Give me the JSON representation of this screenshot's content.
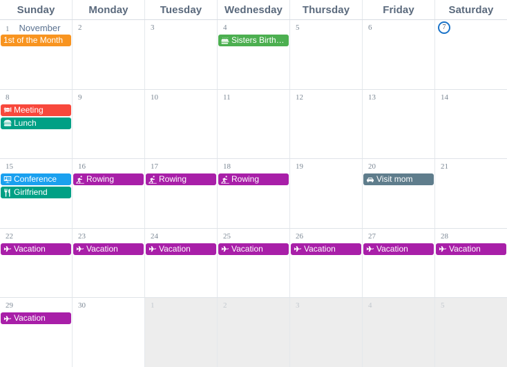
{
  "calendar": {
    "view": "month",
    "month_label": "November",
    "weekday_headers": [
      {
        "label": "Sunday"
      },
      {
        "label": "Monday"
      },
      {
        "label": "Tuesday"
      },
      {
        "label": "Wednesday"
      },
      {
        "label": "Thursday"
      },
      {
        "label": "Friday"
      },
      {
        "label": "Saturday"
      }
    ],
    "colors": {
      "event_orange": "#f89420",
      "event_green": "#4caf50",
      "event_red": "#f8483c",
      "event_teal": "#00a085",
      "event_blue": "#1aa0ef",
      "event_purple": "#a81fa8",
      "event_slate": "#5f7d8c",
      "today_ring": "#1a73c8",
      "other_month_bg": "#ededed",
      "grid_line": "#e4e8ec",
      "header_text": "#5b6a7d",
      "day_number_text": "#7b8794"
    },
    "weeks": [
      {
        "days": [
          {
            "number": "1",
            "other_month": false,
            "today": false,
            "month_label": "November",
            "events": [
              {
                "label": "1st of the Month",
                "icon": "none",
                "color": "#f89420"
              }
            ]
          },
          {
            "number": "2",
            "other_month": false,
            "today": false,
            "events": []
          },
          {
            "number": "3",
            "other_month": false,
            "today": false,
            "events": []
          },
          {
            "number": "4",
            "other_month": false,
            "today": false,
            "events": [
              {
                "label": "Sisters Birth…",
                "icon": "birthday-cake-icon",
                "color": "#4caf50"
              }
            ]
          },
          {
            "number": "5",
            "other_month": false,
            "today": false,
            "events": []
          },
          {
            "number": "6",
            "other_month": false,
            "today": false,
            "events": []
          },
          {
            "number": "7",
            "other_month": false,
            "today": true,
            "events": []
          }
        ]
      },
      {
        "days": [
          {
            "number": "8",
            "other_month": false,
            "today": false,
            "events": [
              {
                "label": "Meeting",
                "icon": "utensils-plate-icon",
                "color": "#f8483c"
              },
              {
                "label": "Lunch",
                "icon": "hamburger-icon",
                "color": "#00a085"
              }
            ]
          },
          {
            "number": "9",
            "other_month": false,
            "today": false,
            "events": []
          },
          {
            "number": "10",
            "other_month": false,
            "today": false,
            "events": []
          },
          {
            "number": "11",
            "other_month": false,
            "today": false,
            "events": []
          },
          {
            "number": "12",
            "other_month": false,
            "today": false,
            "events": []
          },
          {
            "number": "13",
            "other_month": false,
            "today": false,
            "events": []
          },
          {
            "number": "14",
            "other_month": false,
            "today": false,
            "events": []
          }
        ]
      },
      {
        "days": [
          {
            "number": "15",
            "other_month": false,
            "today": false,
            "events": [
              {
                "label": "Conference",
                "icon": "presentation-screen-icon",
                "color": "#1aa0ef"
              },
              {
                "label": "Girlfriend",
                "icon": "fork-knife-icon",
                "color": "#00a085"
              }
            ]
          },
          {
            "number": "16",
            "other_month": false,
            "today": false,
            "events": [
              {
                "label": "Rowing",
                "icon": "rowing-person-icon",
                "color": "#a81fa8"
              }
            ]
          },
          {
            "number": "17",
            "other_month": false,
            "today": false,
            "events": [
              {
                "label": "Rowing",
                "icon": "rowing-person-icon",
                "color": "#a81fa8"
              }
            ]
          },
          {
            "number": "18",
            "other_month": false,
            "today": false,
            "events": [
              {
                "label": "Rowing",
                "icon": "rowing-person-icon",
                "color": "#a81fa8"
              }
            ]
          },
          {
            "number": "19",
            "other_month": false,
            "today": false,
            "events": []
          },
          {
            "number": "20",
            "other_month": false,
            "today": false,
            "events": [
              {
                "label": "Visit mom",
                "icon": "car-icon",
                "color": "#5f7d8c"
              }
            ]
          },
          {
            "number": "21",
            "other_month": false,
            "today": false,
            "events": []
          }
        ]
      },
      {
        "days": [
          {
            "number": "22",
            "other_month": false,
            "today": false,
            "events": [
              {
                "label": "Vacation",
                "icon": "airplane-icon",
                "color": "#a81fa8"
              }
            ]
          },
          {
            "number": "23",
            "other_month": false,
            "today": false,
            "events": [
              {
                "label": "Vacation",
                "icon": "airplane-icon",
                "color": "#a81fa8"
              }
            ]
          },
          {
            "number": "24",
            "other_month": false,
            "today": false,
            "events": [
              {
                "label": "Vacation",
                "icon": "airplane-icon",
                "color": "#a81fa8"
              }
            ]
          },
          {
            "number": "25",
            "other_month": false,
            "today": false,
            "events": [
              {
                "label": "Vacation",
                "icon": "airplane-icon",
                "color": "#a81fa8"
              }
            ]
          },
          {
            "number": "26",
            "other_month": false,
            "today": false,
            "events": [
              {
                "label": "Vacation",
                "icon": "airplane-icon",
                "color": "#a81fa8"
              }
            ]
          },
          {
            "number": "27",
            "other_month": false,
            "today": false,
            "events": [
              {
                "label": "Vacation",
                "icon": "airplane-icon",
                "color": "#a81fa8"
              }
            ]
          },
          {
            "number": "28",
            "other_month": false,
            "today": false,
            "events": [
              {
                "label": "Vacation",
                "icon": "airplane-icon",
                "color": "#a81fa8"
              }
            ]
          }
        ]
      },
      {
        "days": [
          {
            "number": "29",
            "other_month": false,
            "today": false,
            "events": [
              {
                "label": "Vacation",
                "icon": "airplane-icon",
                "color": "#a81fa8"
              }
            ]
          },
          {
            "number": "30",
            "other_month": false,
            "today": false,
            "events": []
          },
          {
            "number": "1",
            "other_month": true,
            "today": false,
            "events": []
          },
          {
            "number": "2",
            "other_month": true,
            "today": false,
            "events": []
          },
          {
            "number": "3",
            "other_month": true,
            "today": false,
            "events": []
          },
          {
            "number": "4",
            "other_month": true,
            "today": false,
            "events": []
          },
          {
            "number": "5",
            "other_month": true,
            "today": false,
            "events": []
          }
        ]
      }
    ]
  }
}
